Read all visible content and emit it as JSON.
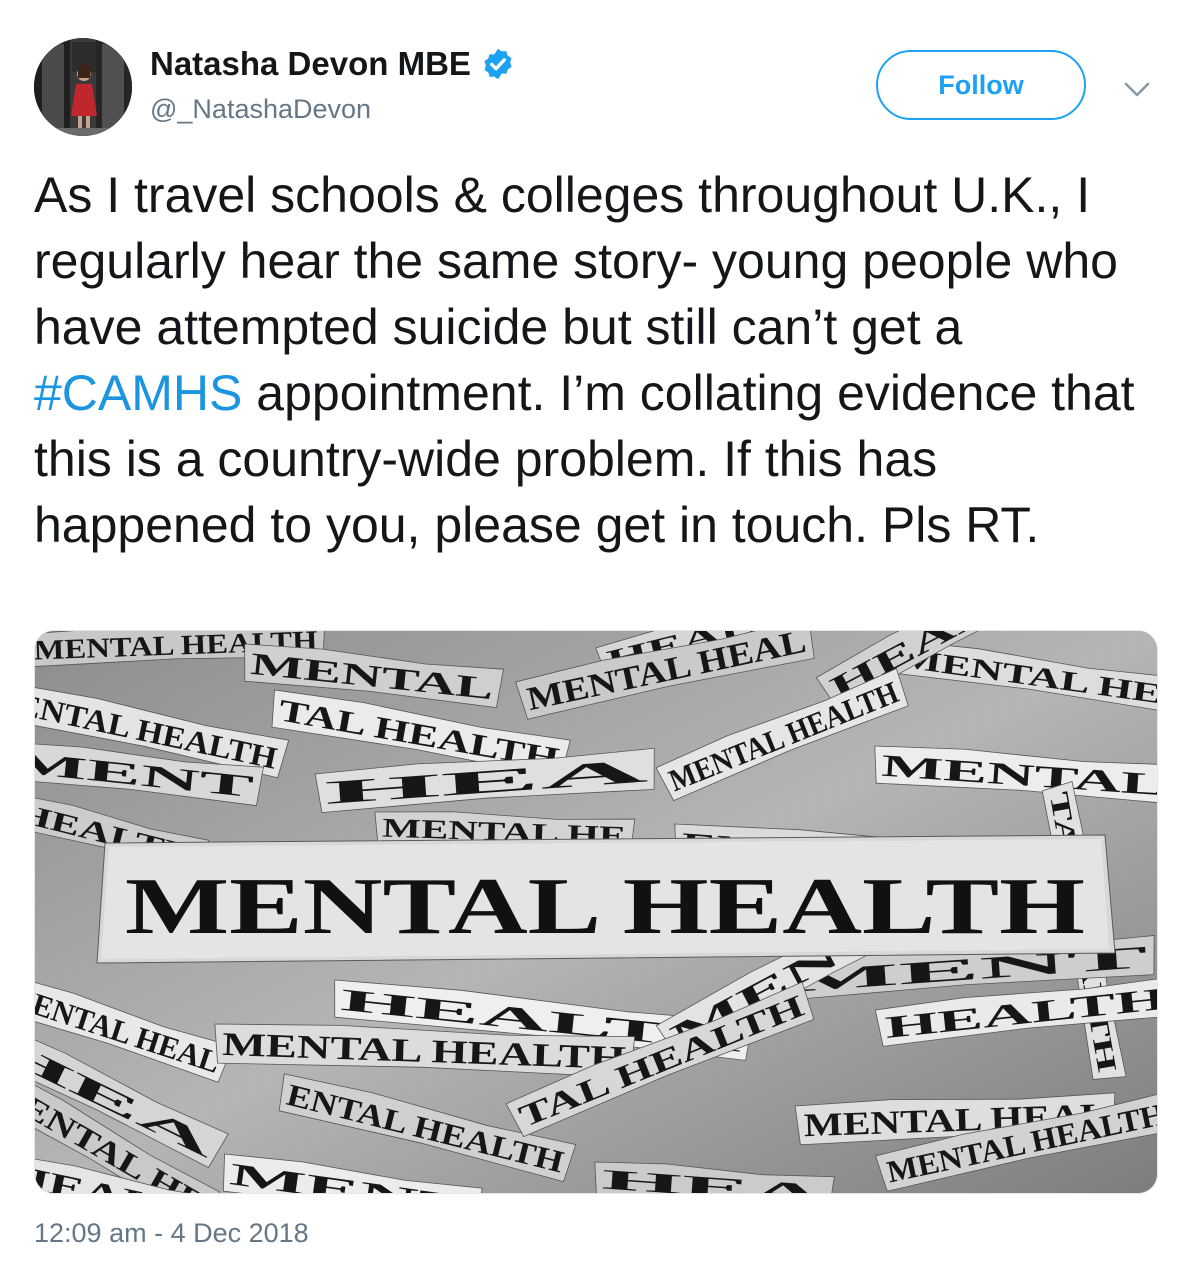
{
  "author": {
    "display_name": "Natasha Devon MBE",
    "handle": "@_NatashaDevon",
    "verified": true,
    "avatar_icon": "profile-photo"
  },
  "follow_button": {
    "label": "Follow"
  },
  "tweet": {
    "text_before_hashtag": "As I travel schools & colleges throughout U.K., I regularly hear the same story- young people who have attempted suicide but still can’t get a ",
    "hashtag": "#CAMHS",
    "text_after_hashtag": " appointment. I’m collating evidence that this is a country-wide problem. If this has happened to you, please get in touch. Pls RT.",
    "timestamp": "12:09 am - 4 Dec 2018"
  },
  "media": {
    "headline": "MENTAL HEALTH",
    "scrap_text": [
      "MENTAL HEALTH",
      "MENTAL",
      "HEALTH",
      "MENTAL HE",
      "ENTAL HEALTH",
      "TAL HEALTH",
      "MENTAL HEAL",
      "HEALTH",
      "MENT",
      "HEA"
    ]
  },
  "colors": {
    "accent": "#1da1f2",
    "hashtag": "#1b95e0",
    "secondary_text": "#657786",
    "primary_text": "#14171a"
  }
}
